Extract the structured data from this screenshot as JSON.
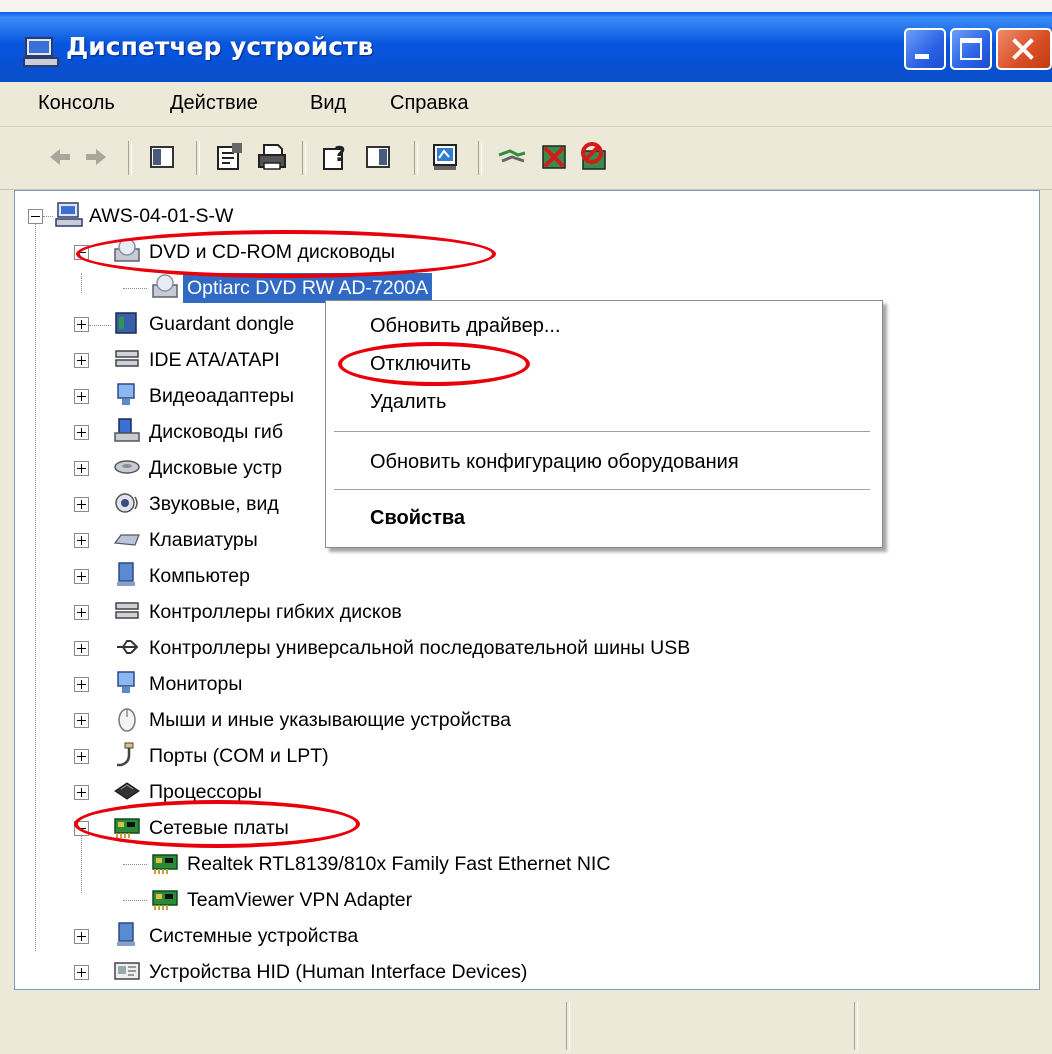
{
  "window": {
    "title": "Диспетчер устройств"
  },
  "menu": [
    "Консоль",
    "Действие",
    "Вид",
    "Справка"
  ],
  "tree": {
    "root": "AWS-04-01-S-W",
    "categories": [
      {
        "label": "DVD и CD-ROM дисководы",
        "icon": "cdrom-icon",
        "expanded": true
      },
      {
        "label": "Optiarc DVD RW AD-7200A",
        "icon": "cdrom-icon",
        "child": true,
        "selected": true
      },
      {
        "label": "Guardant dongle",
        "icon": "dongle-icon"
      },
      {
        "label": "IDE ATA/ATAPI",
        "icon": "ide-controller-icon"
      },
      {
        "label": "Видеоадаптеры",
        "icon": "display-adapter-icon"
      },
      {
        "label": "Дисководы гиб",
        "icon": "floppy-drive-icon"
      },
      {
        "label": "Дисковые устр",
        "icon": "disk-drive-icon"
      },
      {
        "label": "Звуковые, вид",
        "icon": "sound-icon"
      },
      {
        "label": "Клавиатуры",
        "icon": "keyboard-icon"
      },
      {
        "label": "Компьютер",
        "icon": "computer-icon"
      },
      {
        "label": "Контроллеры гибких дисков",
        "icon": "floppy-controller-icon"
      },
      {
        "label": "Контроллеры универсальной последовательной шины USB",
        "icon": "usb-icon"
      },
      {
        "label": "Мониторы",
        "icon": "monitor-icon"
      },
      {
        "label": "Мыши и иные указывающие устройства",
        "icon": "mouse-icon"
      },
      {
        "label": "Порты (COM и LPT)",
        "icon": "port-icon"
      },
      {
        "label": "Процессоры",
        "icon": "cpu-icon"
      },
      {
        "label": "Сетевые платы",
        "icon": "network-card-icon",
        "expanded": true
      },
      {
        "label": "Realtek RTL8139/810x Family Fast Ethernet NIC",
        "icon": "network-card-icon",
        "child": true
      },
      {
        "label": "TeamViewer VPN Adapter",
        "icon": "network-card-icon",
        "child": true
      },
      {
        "label": "Системные устройства",
        "icon": "system-device-icon"
      },
      {
        "label": "Устройства HID (Human Interface Devices)",
        "icon": "hid-icon"
      }
    ]
  },
  "context_menu": {
    "update_driver": "Обновить драйвер...",
    "disable": "Отключить",
    "uninstall": "Удалить",
    "scan_hardware": "Обновить конфигурацию оборудования",
    "properties": "Свойства"
  },
  "colors": {
    "titlebar": "#0a56e0",
    "selection": "#316ac5",
    "annotation": "#e8000b"
  }
}
